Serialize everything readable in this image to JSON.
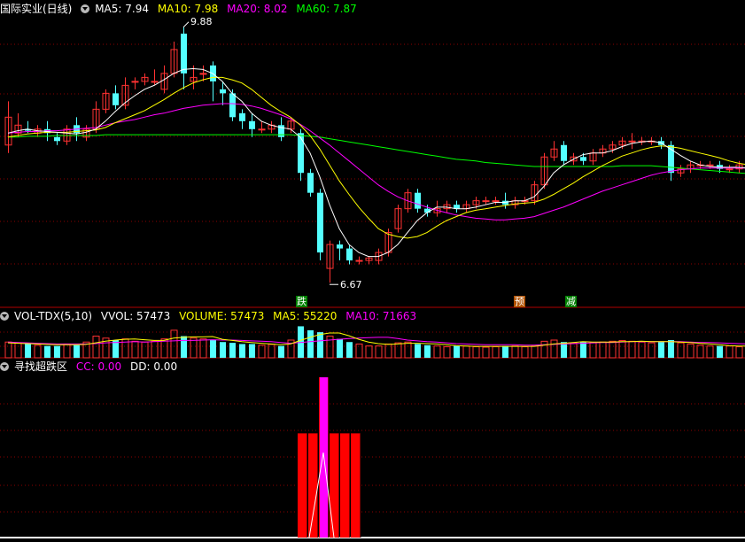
{
  "main_panel": {
    "title": "国际实业(日线)",
    "ma5_label": "MA5: 7.94",
    "ma10_label": "MA10: 7.98",
    "ma20_label": "MA20: 8.02",
    "ma60_label": "MA60: 7.87",
    "high_marker": "9.88",
    "low_marker": "6.67",
    "signal_labels": [
      "跌",
      "预",
      "减"
    ]
  },
  "volume_panel": {
    "name": "VOL-TDX(5,10)",
    "vvol_label": "VVOL: 57473",
    "volume_label": "VOLUME: 57473",
    "ma5_label": "MA5: 55220",
    "ma10_label": "MA10: 71663"
  },
  "indicator_panel": {
    "name": "寻找超跌区",
    "cc_label": "CC: 0.00",
    "dd_label": "DD: 0.00"
  },
  "colors": {
    "up": "#ff3232",
    "down": "#54ffff",
    "ma5": "#ffffff",
    "ma10": "#ffff00",
    "ma20": "#ff00ff",
    "ma60": "#00ff00",
    "signal_bar": "#ff0000",
    "signal_spike": "#ff00ff",
    "grid": "#8b0000"
  },
  "chart_data": {
    "type": "candlestick",
    "price_range": [
      6.5,
      10.0
    ],
    "candles": [
      [
        8.4,
        8.75,
        8.95,
        8.3
      ],
      [
        8.55,
        8.65,
        8.8,
        8.5
      ],
      [
        8.6,
        8.58,
        8.7,
        8.55
      ],
      [
        8.55,
        8.6,
        8.65,
        8.5
      ],
      [
        8.6,
        8.55,
        8.7,
        8.45
      ],
      [
        8.5,
        8.45,
        8.55,
        8.4
      ],
      [
        8.45,
        8.6,
        8.65,
        8.4
      ],
      [
        8.65,
        8.55,
        8.75,
        8.45
      ],
      [
        8.5,
        8.6,
        8.65,
        8.45
      ],
      [
        8.6,
        8.85,
        8.95,
        8.55
      ],
      [
        8.85,
        9.05,
        9.1,
        8.8
      ],
      [
        9.05,
        8.9,
        9.15,
        8.85
      ],
      [
        8.9,
        9.15,
        9.25,
        8.85
      ],
      [
        9.2,
        9.2,
        9.25,
        9.1
      ],
      [
        9.2,
        9.25,
        9.3,
        9.15
      ],
      [
        9.2,
        9.2,
        9.35,
        9.15
      ],
      [
        9.1,
        9.3,
        9.4,
        9.05
      ],
      [
        9.3,
        9.6,
        9.7,
        9.25
      ],
      [
        9.8,
        9.3,
        9.88,
        9.1
      ],
      [
        9.2,
        9.25,
        9.4,
        9.1
      ],
      [
        9.3,
        9.3,
        9.4,
        9.2
      ],
      [
        9.4,
        9.2,
        9.45,
        8.95
      ],
      [
        9.1,
        9.05,
        9.2,
        8.9
      ],
      [
        9.05,
        8.75,
        9.1,
        8.7
      ],
      [
        8.8,
        8.7,
        8.85,
        8.6
      ],
      [
        8.7,
        8.6,
        8.8,
        8.5
      ],
      [
        8.6,
        8.6,
        8.7,
        8.55
      ],
      [
        8.6,
        8.65,
        8.7,
        8.55
      ],
      [
        8.65,
        8.5,
        8.75,
        8.45
      ],
      [
        8.6,
        8.7,
        8.75,
        8.55
      ],
      [
        8.55,
        8.05,
        8.6,
        7.95
      ],
      [
        8.05,
        7.8,
        8.1,
        7.75
      ],
      [
        7.8,
        7.05,
        7.85,
        6.95
      ],
      [
        6.85,
        7.15,
        7.2,
        6.67
      ],
      [
        7.15,
        7.1,
        7.2,
        6.95
      ],
      [
        7.1,
        6.95,
        7.15,
        6.9
      ],
      [
        6.95,
        6.95,
        7.0,
        6.9
      ],
      [
        6.95,
        6.98,
        7.0,
        6.9
      ],
      [
        6.95,
        7.05,
        7.1,
        6.9
      ],
      [
        7.05,
        7.3,
        7.35,
        7.0
      ],
      [
        7.35,
        7.6,
        7.65,
        7.3
      ],
      [
        7.6,
        7.8,
        7.85,
        7.55
      ],
      [
        7.8,
        7.6,
        7.85,
        7.55
      ],
      [
        7.6,
        7.55,
        7.65,
        7.5
      ],
      [
        7.55,
        7.6,
        7.7,
        7.5
      ],
      [
        7.6,
        7.65,
        7.7,
        7.55
      ],
      [
        7.65,
        7.6,
        7.7,
        7.55
      ],
      [
        7.6,
        7.65,
        7.7,
        7.55
      ],
      [
        7.65,
        7.7,
        7.75,
        7.6
      ],
      [
        7.7,
        7.7,
        7.75,
        7.65
      ],
      [
        7.7,
        7.7,
        7.75,
        7.65
      ],
      [
        7.7,
        7.65,
        7.8,
        7.6
      ],
      [
        7.65,
        7.7,
        7.75,
        7.6
      ],
      [
        7.7,
        7.7,
        7.75,
        7.65
      ],
      [
        7.7,
        7.9,
        7.95,
        7.65
      ],
      [
        7.9,
        8.25,
        8.3,
        7.85
      ],
      [
        8.25,
        8.35,
        8.45,
        8.2
      ],
      [
        8.4,
        8.2,
        8.45,
        8.15
      ],
      [
        8.2,
        8.25,
        8.3,
        8.15
      ],
      [
        8.25,
        8.2,
        8.3,
        8.15
      ],
      [
        8.2,
        8.3,
        8.35,
        8.15
      ],
      [
        8.3,
        8.35,
        8.4,
        8.25
      ],
      [
        8.35,
        8.4,
        8.45,
        8.3
      ],
      [
        8.4,
        8.45,
        8.5,
        8.35
      ],
      [
        8.45,
        8.45,
        8.55,
        8.35
      ],
      [
        8.45,
        8.45,
        8.5,
        8.4
      ],
      [
        8.45,
        8.45,
        8.5,
        8.4
      ],
      [
        8.45,
        8.4,
        8.5,
        8.35
      ],
      [
        8.4,
        8.05,
        8.45,
        7.95
      ],
      [
        8.05,
        8.1,
        8.15,
        8.0
      ],
      [
        8.1,
        8.15,
        8.2,
        8.05
      ],
      [
        8.15,
        8.15,
        8.2,
        8.1
      ],
      [
        8.15,
        8.15,
        8.2,
        8.1
      ],
      [
        8.15,
        8.1,
        8.2,
        8.05
      ],
      [
        8.1,
        8.1,
        8.15,
        8.05
      ],
      [
        8.1,
        8.15,
        8.2,
        8.05
      ],
      [
        8.15,
        8.1,
        8.25,
        8.05
      ],
      [
        8.1,
        8.1,
        8.15,
        8.05
      ]
    ],
    "ma5": [
      8.55,
      8.58,
      8.6,
      8.58,
      8.57,
      8.56,
      8.55,
      8.54,
      8.56,
      8.6,
      8.7,
      8.82,
      8.93,
      9.02,
      9.1,
      9.15,
      9.22,
      9.3,
      9.35,
      9.36,
      9.35,
      9.3,
      9.2,
      9.05,
      8.95,
      8.8,
      8.7,
      8.65,
      8.62,
      8.6,
      8.5,
      8.3,
      8.0,
      7.65,
      7.35,
      7.15,
      7.05,
      7.0,
      7.0,
      7.05,
      7.15,
      7.3,
      7.45,
      7.55,
      7.62,
      7.62,
      7.6,
      7.6,
      7.62,
      7.65,
      7.68,
      7.68,
      7.7,
      7.7,
      7.75,
      7.88,
      8.05,
      8.15,
      8.22,
      8.28,
      8.3,
      8.3,
      8.33,
      8.38,
      8.42,
      8.44,
      8.45,
      8.43,
      8.35,
      8.27,
      8.2,
      8.15,
      8.13,
      8.12,
      8.12,
      8.12,
      8.11,
      8.1
    ],
    "ma10": [
      8.5,
      8.52,
      8.54,
      8.55,
      8.56,
      8.56,
      8.56,
      8.57,
      8.58,
      8.59,
      8.62,
      8.68,
      8.73,
      8.78,
      8.83,
      8.9,
      8.97,
      9.05,
      9.12,
      9.18,
      9.22,
      9.25,
      9.25,
      9.22,
      9.18,
      9.1,
      9.0,
      8.9,
      8.82,
      8.75,
      8.65,
      8.52,
      8.35,
      8.15,
      7.95,
      7.78,
      7.62,
      7.48,
      7.35,
      7.28,
      7.25,
      7.23,
      7.25,
      7.3,
      7.38,
      7.45,
      7.5,
      7.55,
      7.58,
      7.6,
      7.62,
      7.64,
      7.66,
      7.67,
      7.68,
      7.72,
      7.78,
      7.85,
      7.92,
      8.0,
      8.07,
      8.14,
      8.2,
      8.26,
      8.3,
      8.34,
      8.37,
      8.39,
      8.38,
      8.36,
      8.33,
      8.3,
      8.27,
      8.24,
      8.2,
      8.17,
      8.15,
      8.14
    ],
    "ma20": [
      8.55,
      8.56,
      8.57,
      8.57,
      8.58,
      8.58,
      8.59,
      8.6,
      8.61,
      8.62,
      8.65,
      8.68,
      8.7,
      8.72,
      8.75,
      8.78,
      8.8,
      8.83,
      8.86,
      8.88,
      8.9,
      8.91,
      8.92,
      8.92,
      8.91,
      8.89,
      8.86,
      8.82,
      8.78,
      8.73,
      8.66,
      8.58,
      8.49,
      8.4,
      8.3,
      8.2,
      8.1,
      8.0,
      7.9,
      7.82,
      7.75,
      7.7,
      7.66,
      7.62,
      7.58,
      7.55,
      7.52,
      7.5,
      7.48,
      7.47,
      7.46,
      7.46,
      7.47,
      7.48,
      7.5,
      7.54,
      7.58,
      7.62,
      7.67,
      7.72,
      7.77,
      7.82,
      7.86,
      7.9,
      7.94,
      7.98,
      8.02,
      8.05,
      8.07,
      8.09,
      8.1,
      8.11,
      8.11,
      8.11,
      8.11,
      8.11,
      8.11,
      8.11
    ],
    "ma60": [
      8.5,
      8.5,
      8.51,
      8.51,
      8.51,
      8.52,
      8.52,
      8.52,
      8.52,
      8.52,
      8.53,
      8.53,
      8.53,
      8.53,
      8.53,
      8.53,
      8.53,
      8.53,
      8.53,
      8.53,
      8.53,
      8.53,
      8.53,
      8.53,
      8.53,
      8.53,
      8.53,
      8.53,
      8.53,
      8.53,
      8.52,
      8.51,
      8.5,
      8.48,
      8.46,
      8.44,
      8.42,
      8.4,
      8.38,
      8.36,
      8.34,
      8.32,
      8.3,
      8.28,
      8.26,
      8.24,
      8.22,
      8.21,
      8.2,
      8.18,
      8.17,
      8.16,
      8.15,
      8.14,
      8.13,
      8.13,
      8.13,
      8.13,
      8.13,
      8.13,
      8.13,
      8.13,
      8.13,
      8.14,
      8.14,
      8.14,
      8.14,
      8.13,
      8.12,
      8.11,
      8.1,
      8.09,
      8.08,
      8.07,
      8.06,
      8.05,
      8.04,
      8.03
    ],
    "volume": [
      40,
      38,
      35,
      32,
      30,
      30,
      35,
      32,
      40,
      55,
      50,
      45,
      48,
      42,
      40,
      42,
      48,
      70,
      55,
      50,
      48,
      45,
      40,
      38,
      35,
      35,
      32,
      34,
      30,
      45,
      80,
      70,
      65,
      55,
      48,
      40,
      35,
      30,
      30,
      35,
      38,
      40,
      35,
      32,
      30,
      28,
      30,
      30,
      28,
      27,
      28,
      30,
      30,
      28,
      30,
      42,
      45,
      40,
      38,
      40,
      38,
      40,
      42,
      44,
      42,
      40,
      38,
      40,
      45,
      38,
      35,
      32,
      30,
      30,
      30,
      28,
      30,
      28
    ],
    "vol_ma5": [
      38,
      37,
      36,
      35,
      34,
      33,
      33,
      33,
      34,
      38,
      42,
      45,
      47,
      48,
      46,
      44,
      44,
      50,
      52,
      53,
      53,
      54,
      47,
      44,
      41,
      39,
      37,
      35,
      33,
      35,
      44,
      52,
      59,
      63,
      63,
      56,
      47,
      40,
      36,
      34,
      35,
      37,
      37,
      36,
      35,
      33,
      31,
      30,
      29,
      29,
      29,
      29,
      29,
      29,
      29,
      32,
      35,
      37,
      39,
      41,
      40,
      40,
      40,
      41,
      41,
      42,
      41,
      41,
      41,
      40,
      39,
      37,
      35,
      33,
      31,
      30,
      30,
      29
    ],
    "vol_ma10": [
      40,
      39,
      38,
      37,
      36,
      35,
      35,
      35,
      35,
      36,
      38,
      39,
      40,
      41,
      40,
      41,
      42,
      43,
      44,
      44,
      45,
      46,
      45,
      45,
      44,
      43,
      42,
      41,
      39,
      37,
      39,
      41,
      43,
      45,
      47,
      49,
      50,
      51,
      52,
      52,
      49,
      45,
      43,
      41,
      40,
      38,
      36,
      35,
      34,
      33,
      33,
      33,
      33,
      32,
      32,
      33,
      34,
      35,
      36,
      37,
      38,
      39,
      39,
      40,
      41,
      41,
      41,
      41,
      41,
      41,
      40,
      39,
      39,
      38,
      37,
      36,
      35,
      34
    ],
    "signal_bars": [
      [
        0,
        0.65
      ],
      [
        1,
        0.65
      ],
      [
        2,
        1.0
      ],
      [
        3,
        0.65
      ],
      [
        4,
        0.65
      ],
      [
        5,
        0.65
      ]
    ]
  }
}
